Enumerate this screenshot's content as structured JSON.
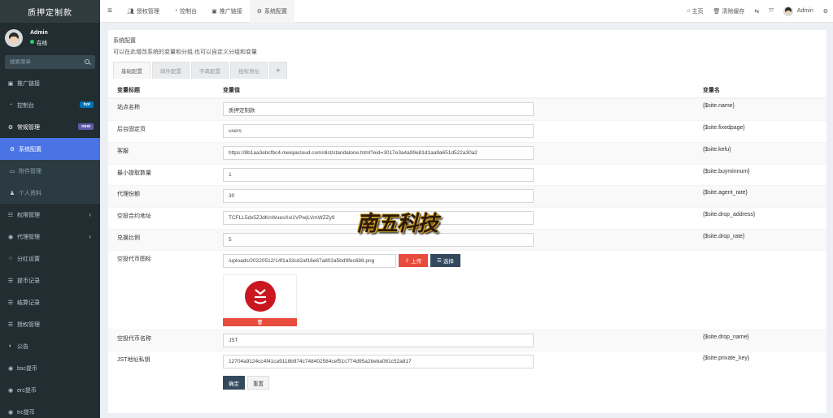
{
  "sidebar": {
    "brand": "质押定制款",
    "user": {
      "name": "Admin",
      "status": "在线"
    },
    "search_placeholder": "搜索菜单",
    "items": [
      {
        "label": "推广链接",
        "icon": "square-icon"
      },
      {
        "label": "控制台",
        "icon": "dashboard-icon",
        "badge": "hot",
        "badge_color": "#0073b7"
      },
      {
        "label": "常规管理",
        "icon": "cogs-icon",
        "badge": "new",
        "badge_color": "#605ca8"
      },
      {
        "label": "系统配置",
        "icon": "gear-icon",
        "active": true
      },
      {
        "label": "附件管理",
        "icon": "file-icon"
      },
      {
        "label": "个人资料",
        "icon": "user-icon"
      },
      {
        "label": "权限管理",
        "icon": "group-icon"
      },
      {
        "label": "代理管理",
        "icon": "user-circle-icon"
      },
      {
        "label": "分红设置",
        "icon": "circle-icon"
      },
      {
        "label": "提币记录",
        "icon": "list-icon"
      },
      {
        "label": "结算记录",
        "icon": "list-icon"
      },
      {
        "label": "授权管理",
        "icon": "list-icon"
      },
      {
        "label": "公告",
        "icon": "half-circle-icon"
      },
      {
        "label": "bsc提币",
        "icon": "user-circle-icon"
      },
      {
        "label": "erc提币",
        "icon": "user-circle-icon"
      },
      {
        "label": "trc提币",
        "icon": "user-circle-icon"
      }
    ]
  },
  "topnav": {
    "tabs": [
      {
        "label": "授权管理",
        "icon": "users-icon"
      },
      {
        "label": "控制台",
        "icon": "dashboard-icon"
      },
      {
        "label": "推广链接",
        "icon": "square-icon"
      },
      {
        "label": "系统配置",
        "icon": "gear-icon",
        "active": true
      }
    ],
    "right": {
      "home": "主页",
      "clear_cache": "清除缓存",
      "user": "Admin"
    }
  },
  "panel": {
    "title": "系统配置",
    "description": "可以在此增改系统的变量和分组,也可以自定义分组和变量",
    "tabs": [
      "基础配置",
      "邮件配置",
      "字典配置",
      "授权地址",
      "+"
    ],
    "columns": [
      "变量标题",
      "变量值",
      "变量名"
    ],
    "rows": [
      {
        "title": "站点名称",
        "value": "质押定制款",
        "name": "{$site.name}"
      },
      {
        "title": "后台固定页",
        "value": "users",
        "name": "{$site.fixedpage}"
      },
      {
        "title": "客服",
        "value": "https://8b1aa3ebcfbc4.meiqiacloud.com/dist/standalone.html?eid=3017e3a4a99e81d1aa9a651d522a30a2",
        "name": "{$site.kefu}"
      },
      {
        "title": "最小提取数量",
        "value": "1",
        "name": "{$site.buyminnum}"
      },
      {
        "title": "代理份额",
        "value": "30",
        "name": "{$site.agent_rate}"
      },
      {
        "title": "空投合约地址",
        "value": "TCFLL5dx5ZJdKnWuesXxi1VPwjLVmWZZy9",
        "name": "{$site.drop_address}"
      },
      {
        "title": "兑换比例",
        "value": "5",
        "name": "{$site.drop_rate}"
      },
      {
        "title": "空投代币图标",
        "value": "/uploads/20220512/14f1a33cd2af16e67a802a5bd9fec688.png",
        "name": "{$site.drop_logo}"
      },
      {
        "title": "空投代币名称",
        "value": "JST",
        "name": "{$site.drop_name}"
      },
      {
        "title": "JST地址私钥",
        "value": "12704a9124cc4f41ca9118b974c748402584cef51c774d95a2beba081c52a817",
        "name": "{$site.private_key}"
      }
    ],
    "upload_label": "上传",
    "choose_label": "选择",
    "confirm_label": "确定",
    "reset_label": "重置"
  },
  "watermark": "南五科技"
}
